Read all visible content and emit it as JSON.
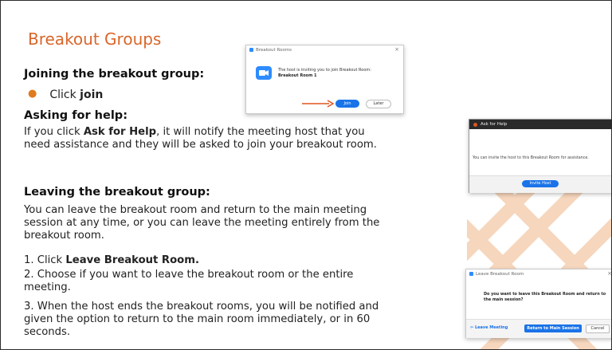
{
  "title": "Breakout Groups",
  "joining": {
    "heading": "Joining the breakout group:",
    "bullet_prefix": "Click ",
    "bullet_bold": "join"
  },
  "help": {
    "heading": "Asking for help:",
    "pre": "If you click ",
    "bold": "Ask for Help",
    "line1_rest": ", it will notify the meeting host that you",
    "line2": "need assistance and they will be asked to join your breakout room."
  },
  "leaving": {
    "heading": "Leaving the breakout group:",
    "intro_lines": [
      "You can leave the breakout room and return to the main meeting",
      "session at any time, or you can leave the meeting entirely from the",
      "breakout room."
    ],
    "step1_prefix": "1. Click ",
    "step1_bold": "Leave Breakout Room.",
    "step2_lines": [
      "2. Choose if you want to leave the breakout room or the entire",
      "meeting."
    ],
    "step3_lines": [
      "3. When the host ends the breakout rooms, you will be notified and",
      "given the option to return to the main room immediately, or in 60",
      "seconds."
    ]
  },
  "dialog_invite": {
    "window_title": "Breakout Rooms",
    "message": "The host is inviting you to join Breakout Room:",
    "room": "Breakout Room 1",
    "join_label": "Join",
    "later_label": "Later"
  },
  "dialog_help": {
    "window_title": "Ask for Help",
    "message": "You can invite the host to this Breakout Room for assistance.",
    "button_label": "Invite Host"
  },
  "dialog_leave": {
    "window_title": "Leave Breakout Room",
    "message_lines": [
      "Do you want to leave this Breakout Room and return to",
      "the main session?"
    ],
    "leave_meeting_label": "Leave Meeting",
    "return_label": "Return to Main Session",
    "cancel_label": "Cancel"
  },
  "colors": {
    "title": "#d9662a",
    "bullet": "#e07a1f",
    "zoom_blue": "#2d8cff",
    "help_title_bar": "#2a2a2a",
    "watermark": "#f3c9a6"
  }
}
